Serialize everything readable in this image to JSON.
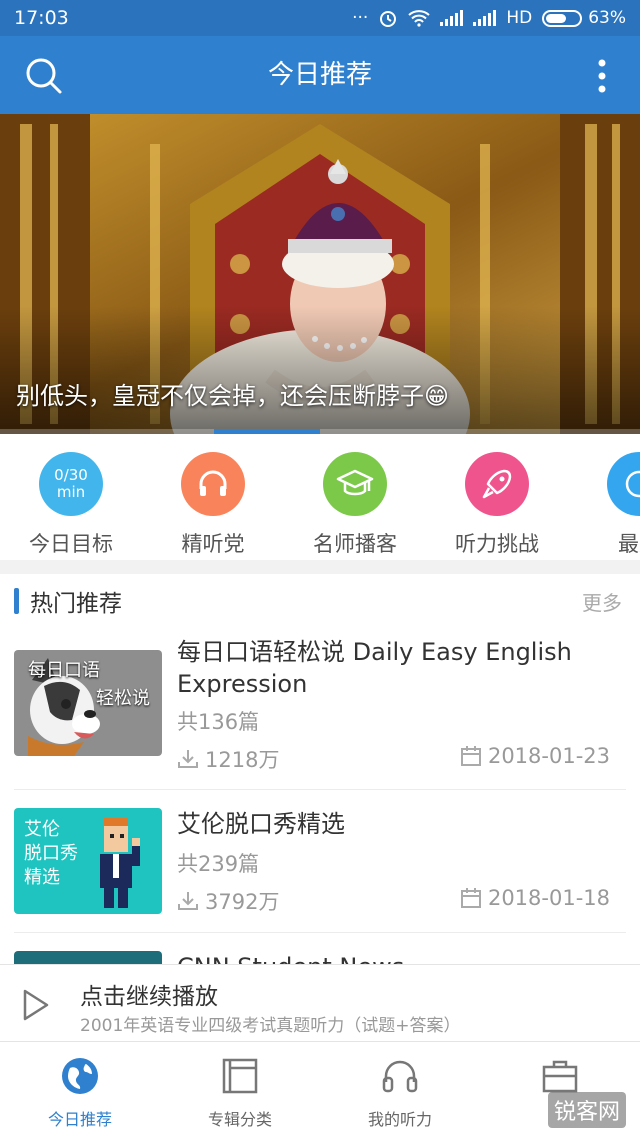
{
  "status_bar": {
    "time": "17:03",
    "dots": "···",
    "network": "HD",
    "battery_percent": "63%",
    "battery_level": 0.63
  },
  "app_bar": {
    "title": "今日推荐",
    "search_icon": "search-icon",
    "more_icon": "more-vert-icon"
  },
  "banner": {
    "caption": "别低头，皇冠不仅会掉，还会压断脖子😁",
    "active_index": 2
  },
  "quick": [
    {
      "label": "今日目标",
      "badge_top": "0/30",
      "badge_bottom": "min",
      "color": "#42b6ec",
      "icon": "goal-icon"
    },
    {
      "label": "精听党",
      "color": "#f9835a",
      "icon": "headphones-icon"
    },
    {
      "label": "名师播客",
      "color": "#7cc94a",
      "icon": "graduation-cap-icon"
    },
    {
      "label": "听力挑战",
      "color": "#f0548d",
      "icon": "rocket-icon"
    },
    {
      "label": "最近",
      "color": "#34a6ef",
      "icon": "recent-icon"
    }
  ],
  "section": {
    "title": "热门推荐",
    "more": "更多"
  },
  "items": [
    {
      "title": "每日口语轻松说 Daily Easy English Expression",
      "count": "共136篇",
      "plays": "1218万",
      "date": "2018-01-23",
      "thumb_text_1": "每日口语",
      "thumb_text_2": "轻松说",
      "thumb_color": "#8e8e8e"
    },
    {
      "title": "艾伦脱口秀精选",
      "count": "共239篇",
      "plays": "3792万",
      "date": "2018-01-18",
      "thumb_text_1": "艾伦",
      "thumb_text_2": "脱口秀",
      "thumb_text_3": "精选",
      "thumb_color": "#1fc4c0"
    },
    {
      "title": "CNN Student News",
      "thumb_color": "#1d6e7a"
    }
  ],
  "player": {
    "title": "点击继续播放",
    "subtitle": "2001年英语专业四级考试真题听力（试题+答案）"
  },
  "tabs": [
    {
      "label": "今日推荐",
      "icon": "globe-icon",
      "active": true
    },
    {
      "label": "专辑分类",
      "icon": "album-icon",
      "active": false
    },
    {
      "label": "我的听力",
      "icon": "headphones-icon",
      "active": false
    },
    {
      "label": "",
      "icon": "briefcase-icon",
      "active": false
    }
  ],
  "watermark": "锐客网",
  "colors": {
    "primary": "#2f80cf",
    "status_bar": "#2b74bd",
    "text_secondary": "#999999"
  }
}
